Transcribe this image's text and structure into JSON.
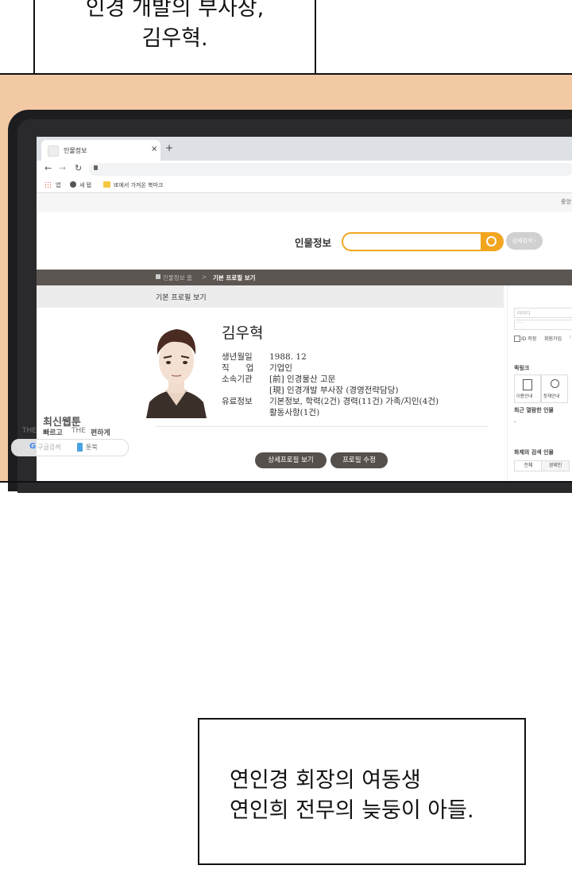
{
  "speech_top": {
    "line1": "인경 개발의 부사장,",
    "line2": "김우혁."
  },
  "speech_bottom": {
    "line1": "연인경 회장의 여동생",
    "line2": "연인희 전무의 늦둥이 아들."
  },
  "browser": {
    "tab_title": "인물정보",
    "tab_close": "×",
    "tab_new": "+",
    "bookmarks": {
      "apps": "앱",
      "new_tab": "새 탭",
      "imported": "IE에서 가져온 북마크"
    }
  },
  "site": {
    "top_right": "중앙",
    "logo": "인물정보",
    "search_placeholder": "",
    "detail_search_button": "상세검색 ›",
    "breadcrumb_home": "인물정보 홈",
    "breadcrumb_sep": ">",
    "breadcrumb_current": "기본 프로필 보기",
    "section_title": "기본 프로필 보기",
    "profile": {
      "name": "김우혁",
      "rows": [
        {
          "label": "생년월일",
          "value": "1988. 12"
        },
        {
          "label": "직　　업",
          "value": "기업인"
        },
        {
          "label": "소속기관",
          "value": "[前] 인경물산 고문"
        },
        {
          "label": "",
          "value": "[現] 인경개발 부사장 (경영전략담당)"
        },
        {
          "label": "유료정보",
          "value": "기본정보, 학력(2건) 경력(11건) 가족/지인(4건)"
        },
        {
          "label": "",
          "value": "활동사항(1건)"
        }
      ]
    },
    "detail_profile_button": "상세프로필 보기",
    "edit_profile_button": "프로필 수정",
    "sidebar": {
      "id_placeholder": "아이디",
      "pw_placeholder": "····",
      "save_id": "ID 저장",
      "join": "회원가입",
      "sep": "I",
      "quicklinks_title": "퀵링크",
      "quick1": "이용안내",
      "quick2": "등재안내",
      "recent_title": "최근 열람한 인물",
      "recent_dash": "-",
      "topic_title": "화제의 검색 인물",
      "topic_tab1": "전체",
      "topic_tab2": "경제인"
    }
  },
  "watermark": {
    "title": "최신웹툰",
    "sub1": "THE",
    "sub2": "빠르고",
    "sub3": "THE",
    "sub4": "편하게",
    "google": "구글검색",
    "toonbook": "툰북"
  },
  "colors": {
    "panel_bg": "#f3c9a4",
    "search_border": "#f2a51f",
    "navbar": "#5c5652",
    "button": "#56504c"
  }
}
